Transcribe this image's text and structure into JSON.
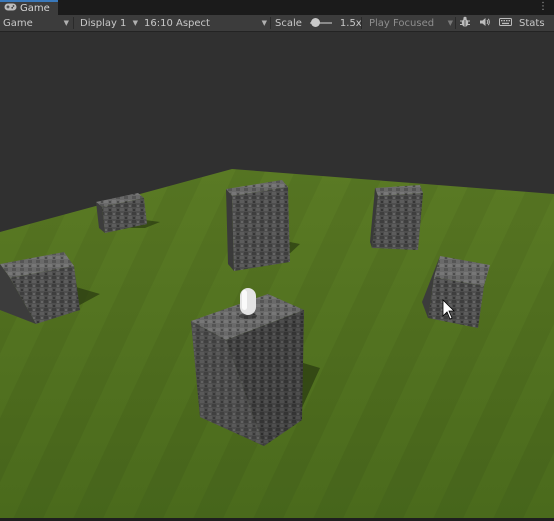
{
  "tab": {
    "title": "Game",
    "icon": "gamepad-icon"
  },
  "toolbar": {
    "view_select": "Game",
    "display_select": "Display 1",
    "aspect_select": "16:10 Aspect",
    "scale_label": "Scale",
    "scale_value": "1.5x",
    "scale_level": 0.25,
    "play_mode": "Play Focused",
    "gizmo_icon": "bug-icon",
    "audio_icon": "speaker-icon",
    "keyboard_icon": "keyboard-icon",
    "stats_label": "Stats"
  },
  "colors": {
    "panel": "#3c3c3c",
    "tab_accent": "#3a79bb",
    "sky": "#303030",
    "grass": "#4f6c20",
    "stone": "#585858"
  }
}
